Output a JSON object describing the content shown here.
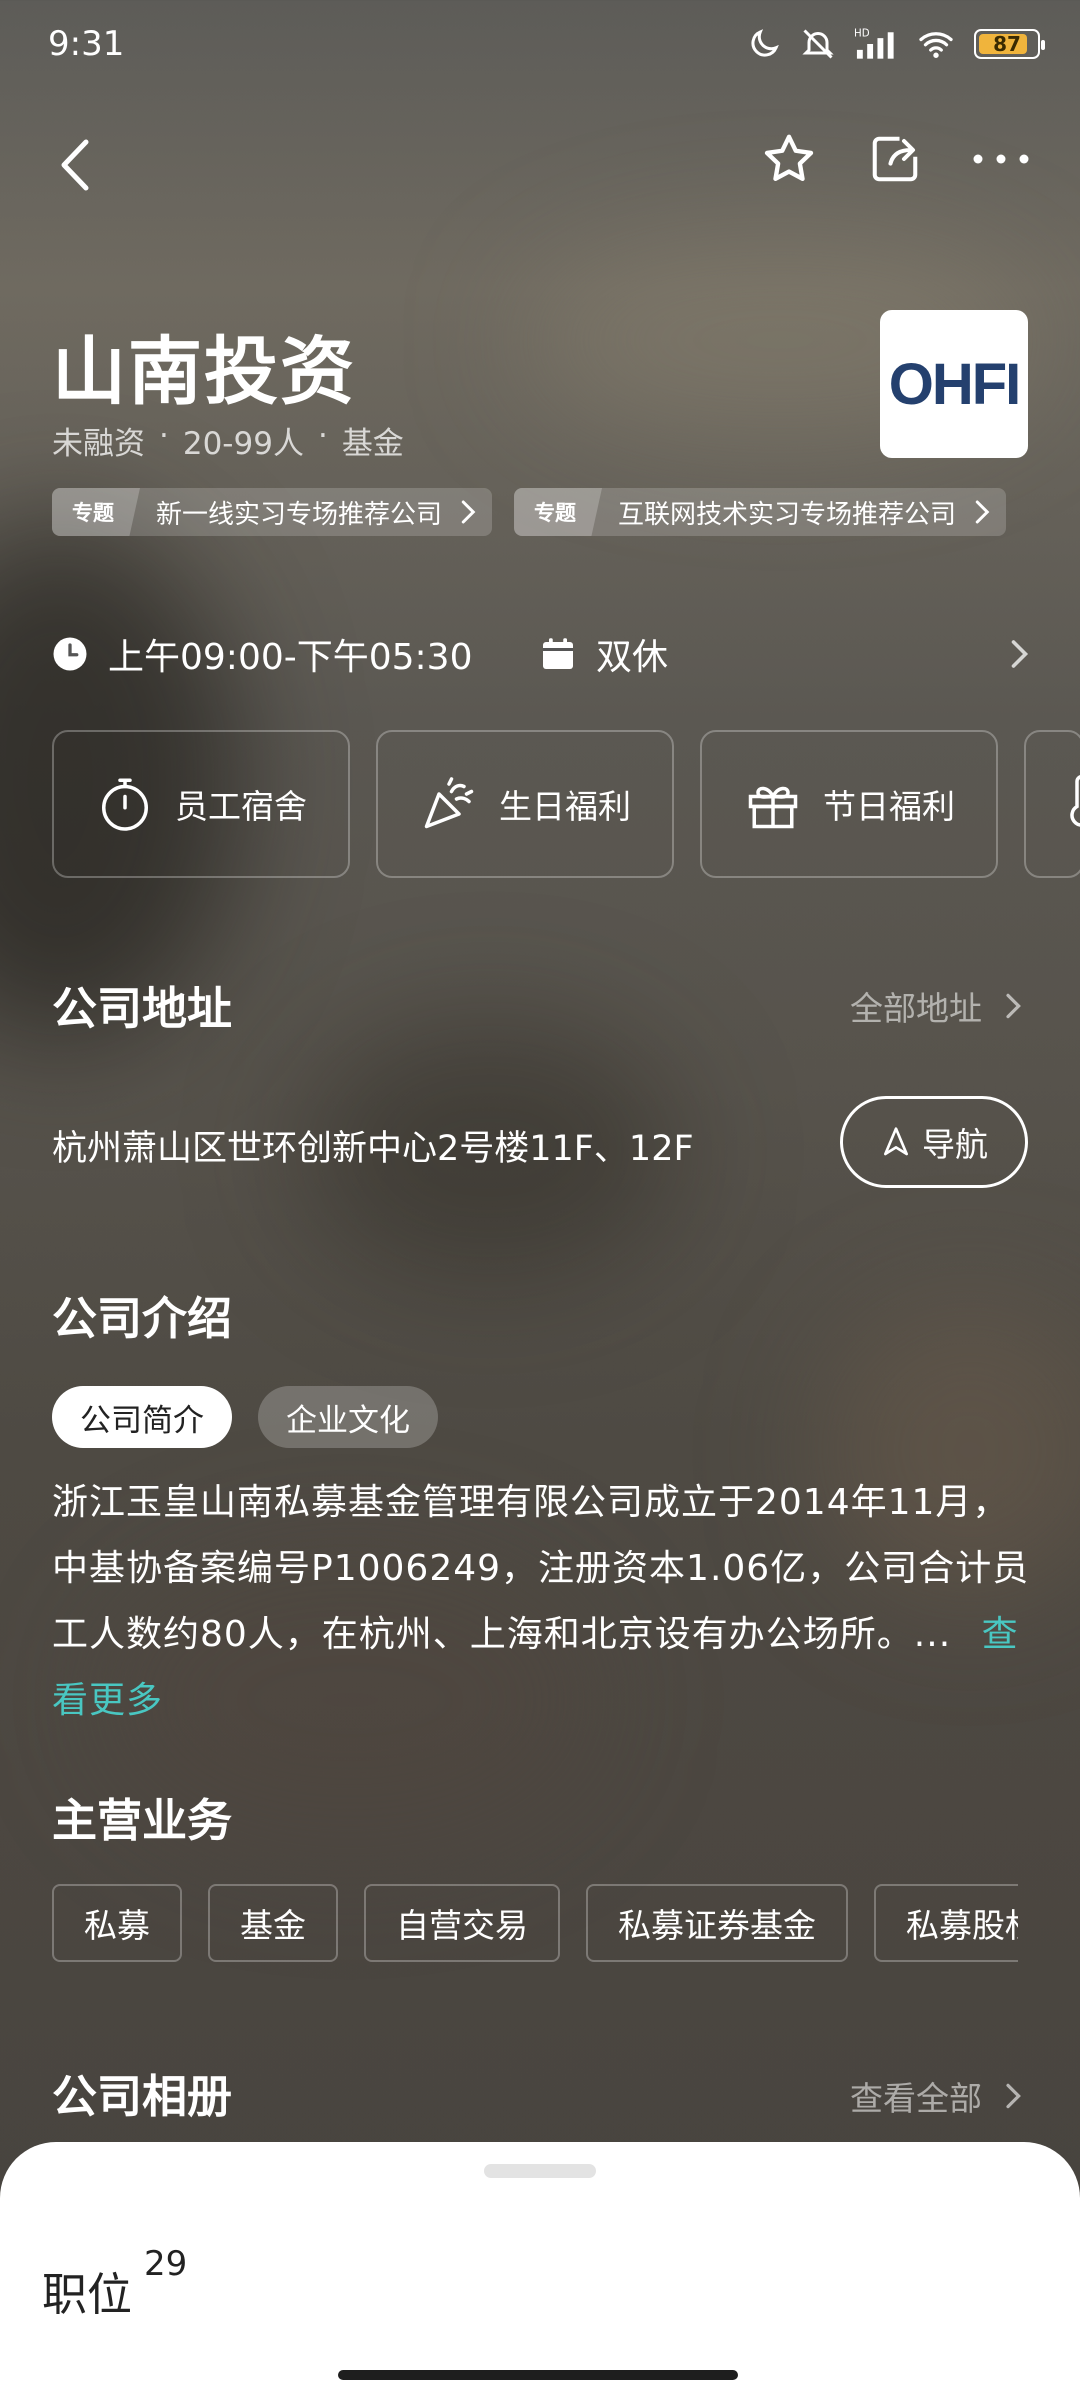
{
  "status_bar": {
    "time": "9:31",
    "battery": "87"
  },
  "company": {
    "name": "山南投资",
    "meta": [
      "未融资",
      "·",
      "20-99人",
      "·",
      "基金"
    ],
    "logo_text": "OHFI"
  },
  "topics": [
    {
      "tag": "专题",
      "text": "新一线实习专场推荐公司"
    },
    {
      "tag": "专题",
      "text": "互联网技术实习专场推荐公司"
    }
  ],
  "hours": {
    "time": "上午09:00-下午05:30",
    "rest": "双休"
  },
  "benefits": [
    {
      "label": "员工宿舍",
      "icon": "stopwatch-icon"
    },
    {
      "label": "生日福利",
      "icon": "party-popper-icon"
    },
    {
      "label": "节日福利",
      "icon": "gift-icon"
    }
  ],
  "address_section": {
    "title": "公司地址",
    "see_all": "全部地址",
    "address": "杭州萧山区世环创新中心2号楼11F、12F",
    "nav_label": "导航"
  },
  "intro_section": {
    "title": "公司介绍",
    "tabs": [
      "公司简介",
      "企业文化"
    ],
    "text": "浙江玉皇山南私募基金管理有限公司成立于2014年11月，中基协备案编号P1006249，注册资本1.06亿，公司合计员工人数约80人，在杭州、上海和北京设有办公场所。...",
    "more": "查看更多"
  },
  "business_section": {
    "title": "主营业务",
    "items": [
      "私募",
      "基金",
      "自营交易",
      "私募证券基金",
      "私募股权基"
    ]
  },
  "album_section": {
    "title": "公司相册",
    "see_all": "查看全部"
  },
  "jobs": {
    "label": "职位",
    "count": "29"
  }
}
